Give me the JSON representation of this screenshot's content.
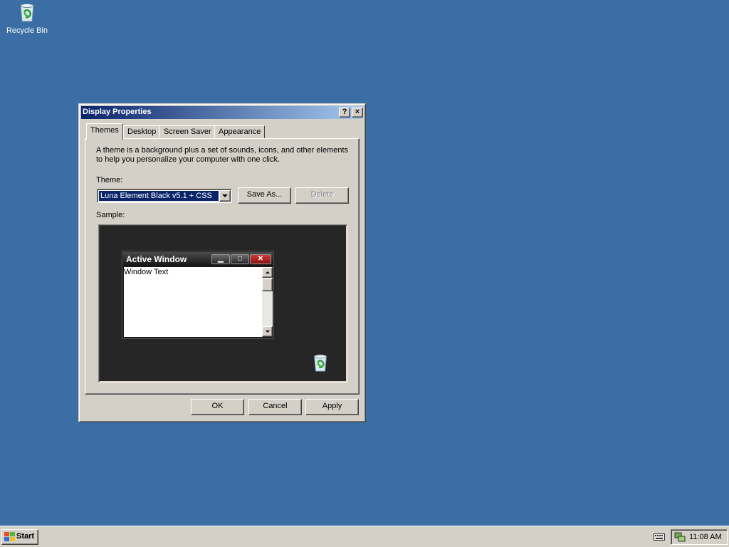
{
  "desktop": {
    "background": "#3a6ea5",
    "icons": [
      {
        "label": "Recycle Bin",
        "icon": "recycle-bin-icon"
      }
    ]
  },
  "dialog": {
    "title": "Display Properties",
    "help_button": "?",
    "close_button": "×",
    "tabs": [
      {
        "label": "Themes",
        "active": true
      },
      {
        "label": "Desktop",
        "active": false
      },
      {
        "label": "Screen Saver",
        "active": false
      },
      {
        "label": "Appearance",
        "active": false
      }
    ],
    "description_line1": "A theme is a background plus a set of sounds, icons, and other elements",
    "description_line2": "to help you personalize your computer with one click.",
    "theme_label": "Theme:",
    "theme_value": "Luna Element Black v5.1 + CSS",
    "save_as_label": "Save As...",
    "delete_label": "Delete",
    "sample_label": "Sample:",
    "sample": {
      "window_title": "Active Window",
      "window_text": "Window Text",
      "minimize": "▁",
      "maximize": "□",
      "close": "✕"
    },
    "ok_label": "OK",
    "cancel_label": "Cancel",
    "apply_label": "Apply"
  },
  "taskbar": {
    "start_label": "Start",
    "clock": "11:08 AM"
  }
}
